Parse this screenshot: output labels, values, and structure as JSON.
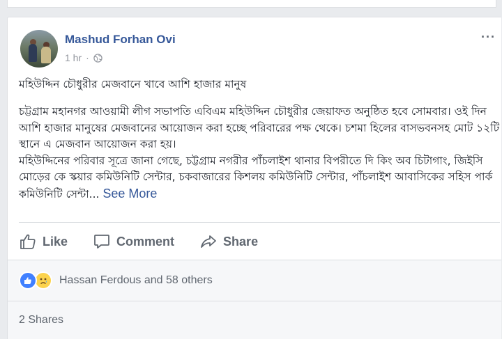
{
  "post": {
    "author": "Mashud Forhan Ovi",
    "time": "1 hr",
    "more_label": "···",
    "headline": "মহিউদ্দিন চৌধুরীর মেজবানে খাবে আশি হাজার মানুষ",
    "paragraphs": [
      "চট্টগ্রাম মহানগর আওয়ামী লীগ সভাপতি এবিএম মহিউদ্দিন চৌধুরীর জেয়াফত অনুষ্ঠিত হবে সোমবার।  ওই দিন আশি হাজার মানুষের মেজবানের আয়োজন করা হচ্ছে পরিবারের পক্ষ থেকে। চশমা হিলের বাসভবনসহ মোট ১২টি স্থানে এ মেজবান আয়োজন করা হয়।",
      "মহিউদ্দিনের পরিবার সূত্রে জানা গেছে, চট্টগ্রাম নগরীর পাঁচলাইশ থানার বিপরীতে দি কিং অব চিটাগাং, জিইসি মোড়ের কে স্কয়ার কমিউনিটি সেন্টার, চকবাজারের কিশলয় কমিউনিটি সেন্টার, পাঁচলাইশ আবাসিকের সহিস পার্ক কমিউনিটি সেন্টা..."
    ],
    "see_more": "See More"
  },
  "actions": {
    "like": "Like",
    "comment": "Comment",
    "share": "Share"
  },
  "reactions": {
    "icons": [
      "like-icon",
      "sad-icon"
    ],
    "names": "Hassan Ferdous and 58 others",
    "like_color": "#4080ff",
    "sad_color": "#fcd34d"
  },
  "shares": {
    "label": "2 Shares"
  },
  "colors": {
    "link": "#365899",
    "text": "#1d2129",
    "muted": "#606770",
    "background": "#e9ebee"
  }
}
